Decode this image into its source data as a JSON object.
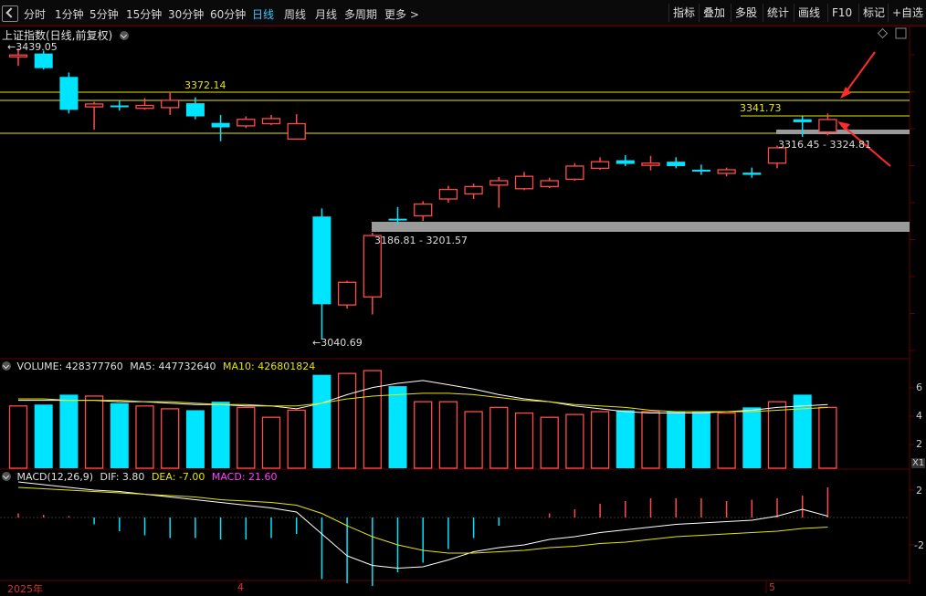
{
  "toolbar": {
    "periods": [
      "分时",
      "1分钟",
      "5分钟",
      "15分钟",
      "30分钟",
      "60分钟",
      "日线",
      "周线",
      "月线",
      "多周期",
      "更多 >"
    ],
    "active": "日线",
    "right_items": [
      "指标",
      "叠加",
      "多股",
      "统计",
      "画线",
      "F10",
      "标记",
      "+自选"
    ]
  },
  "main": {
    "title": "上证指数(日线,前复权)",
    "price_high_label": "3439.05",
    "price_low_label": "3040.69",
    "level_3372": "3372.14",
    "level_3341": "3341.73",
    "gap_upper_label": "3316.45 - 3324.81",
    "gap_lower_label": "3186.81 - 3201.57",
    "up_color": "#ff4a4a",
    "down_color": "#00e5ff",
    "line_color": "#e6e600"
  },
  "volume": {
    "title": "VOLUME: 428377760",
    "ma5": "MA5: 447732640",
    "ma10": "MA10: 426801824",
    "ticks": [
      "6",
      "4",
      "2"
    ],
    "unit": "X1"
  },
  "macd": {
    "title": "MACD(12,26,9)",
    "dif": "DIF: 3.80",
    "dea": "DEA: -7.00",
    "macd": "MACD: 21.60",
    "ticks": [
      "2",
      "-2"
    ]
  },
  "xaxis": {
    "labels": [
      "2025年",
      "4",
      "5"
    ]
  },
  "chart_data": {
    "type": "candlestick",
    "candles": [
      {
        "o": 3430,
        "c": 3430,
        "h": 3439.05,
        "l": 3415,
        "dir": "up"
      },
      {
        "o": 3432,
        "c": 3412,
        "h": 3436,
        "l": 3410,
        "dir": "down"
      },
      {
        "o": 3400,
        "c": 3355,
        "h": 3406,
        "l": 3350,
        "dir": "down"
      },
      {
        "o": 3359,
        "c": 3363,
        "h": 3366,
        "l": 3328,
        "dir": "up"
      },
      {
        "o": 3361,
        "c": 3359,
        "h": 3368,
        "l": 3354,
        "dir": "down"
      },
      {
        "o": 3357,
        "c": 3361,
        "h": 3371,
        "l": 3355,
        "dir": "up"
      },
      {
        "o": 3358,
        "c": 3368,
        "h": 3380,
        "l": 3348,
        "dir": "up"
      },
      {
        "o": 3364,
        "c": 3346,
        "h": 3372.14,
        "l": 3342,
        "dir": "down"
      },
      {
        "o": 3337,
        "c": 3331,
        "h": 3348,
        "l": 3312,
        "dir": "down"
      },
      {
        "o": 3333,
        "c": 3342,
        "h": 3346,
        "l": 3330,
        "dir": "up"
      },
      {
        "o": 3336,
        "c": 3343,
        "h": 3348,
        "l": 3334,
        "dir": "up"
      },
      {
        "o": 3315,
        "c": 3336,
        "h": 3349,
        "l": 3315,
        "dir": "up"
      },
      {
        "o": 3209,
        "c": 3089,
        "h": 3220,
        "l": 3040.69,
        "dir": "down"
      },
      {
        "o": 3088,
        "c": 3119,
        "h": 3121,
        "l": 3083,
        "dir": "up"
      },
      {
        "o": 3099,
        "c": 3183,
        "h": 3186.81,
        "l": 3075,
        "dir": "up"
      },
      {
        "o": 3204,
        "c": 3206,
        "h": 3222,
        "l": 3198,
        "dir": "down"
      },
      {
        "o": 3210,
        "c": 3226,
        "h": 3230,
        "l": 3203,
        "dir": "up"
      },
      {
        "o": 3233,
        "c": 3246,
        "h": 3251,
        "l": 3228,
        "dir": "up"
      },
      {
        "o": 3240,
        "c": 3250,
        "h": 3254,
        "l": 3233,
        "dir": "up"
      },
      {
        "o": 3252,
        "c": 3258,
        "h": 3263,
        "l": 3221,
        "dir": "up"
      },
      {
        "o": 3247,
        "c": 3264,
        "h": 3270,
        "l": 3245,
        "dir": "up"
      },
      {
        "o": 3250,
        "c": 3258,
        "h": 3262,
        "l": 3248,
        "dir": "up"
      },
      {
        "o": 3260,
        "c": 3278,
        "h": 3282,
        "l": 3258,
        "dir": "up"
      },
      {
        "o": 3275,
        "c": 3284,
        "h": 3290,
        "l": 3273,
        "dir": "up"
      },
      {
        "o": 3286,
        "c": 3281,
        "h": 3293,
        "l": 3278,
        "dir": "down"
      },
      {
        "o": 3279,
        "c": 3282,
        "h": 3292,
        "l": 3272,
        "dir": "up"
      },
      {
        "o": 3284,
        "c": 3278,
        "h": 3290,
        "l": 3275,
        "dir": "down"
      },
      {
        "o": 3273,
        "c": 3272,
        "h": 3280,
        "l": 3266,
        "dir": "down"
      },
      {
        "o": 3268,
        "c": 3273,
        "h": 3276,
        "l": 3264,
        "dir": "up"
      },
      {
        "o": 3269,
        "c": 3266,
        "h": 3276,
        "l": 3262,
        "dir": "down"
      },
      {
        "o": 3282,
        "c": 3303,
        "h": 3306,
        "l": 3275,
        "dir": "up"
      },
      {
        "o": 3342,
        "c": 3338,
        "h": 3346,
        "l": 3318,
        "dir": "down"
      },
      {
        "o": 3324.81,
        "c": 3341.73,
        "h": 3350,
        "l": 3320,
        "dir": "up"
      }
    ],
    "volumes": [
      {
        "v": 4.4,
        "dir": "up"
      },
      {
        "v": 4.5,
        "dir": "down"
      },
      {
        "v": 5.2,
        "dir": "down"
      },
      {
        "v": 5.1,
        "dir": "up"
      },
      {
        "v": 4.6,
        "dir": "down"
      },
      {
        "v": 4.4,
        "dir": "up"
      },
      {
        "v": 4.2,
        "dir": "up"
      },
      {
        "v": 4.1,
        "dir": "down"
      },
      {
        "v": 4.7,
        "dir": "down"
      },
      {
        "v": 4.3,
        "dir": "up"
      },
      {
        "v": 3.6,
        "dir": "up"
      },
      {
        "v": 4.1,
        "dir": "up"
      },
      {
        "v": 6.6,
        "dir": "down"
      },
      {
        "v": 6.7,
        "dir": "up"
      },
      {
        "v": 6.9,
        "dir": "up"
      },
      {
        "v": 5.8,
        "dir": "down"
      },
      {
        "v": 4.7,
        "dir": "up"
      },
      {
        "v": 4.7,
        "dir": "up"
      },
      {
        "v": 4.0,
        "dir": "up"
      },
      {
        "v": 4.3,
        "dir": "up"
      },
      {
        "v": 3.9,
        "dir": "up"
      },
      {
        "v": 3.6,
        "dir": "up"
      },
      {
        "v": 3.8,
        "dir": "up"
      },
      {
        "v": 4.0,
        "dir": "up"
      },
      {
        "v": 4.1,
        "dir": "down"
      },
      {
        "v": 4.0,
        "dir": "up"
      },
      {
        "v": 4.0,
        "dir": "down"
      },
      {
        "v": 4.0,
        "dir": "down"
      },
      {
        "v": 3.9,
        "dir": "up"
      },
      {
        "v": 4.3,
        "dir": "down"
      },
      {
        "v": 4.7,
        "dir": "up"
      },
      {
        "v": 5.2,
        "dir": "down"
      },
      {
        "v": 4.3,
        "dir": "up"
      }
    ],
    "macd_hist": [
      0.3,
      0.2,
      0.1,
      -0.5,
      -1.0,
      -1.3,
      -1.5,
      -1.5,
      -1.6,
      -1.6,
      -1.5,
      -1.2,
      -4.5,
      -4.8,
      -5.0,
      -4.0,
      -3.3,
      -2.3,
      -1.5,
      -0.6,
      0,
      0.3,
      0.6,
      1.0,
      1.2,
      1.4,
      1.4,
      1.4,
      1.2,
      1.3,
      1.4,
      1.6,
      2.2
    ],
    "dif": [
      2.6,
      2.4,
      2.2,
      2.0,
      1.9,
      1.7,
      1.5,
      1.3,
      1.1,
      0.9,
      0.7,
      0.4,
      -1.2,
      -2.8,
      -3.5,
      -3.7,
      -3.6,
      -3.1,
      -2.5,
      -2.2,
      -2.0,
      -1.6,
      -1.4,
      -1.1,
      -0.9,
      -0.7,
      -0.5,
      -0.4,
      -0.3,
      -0.2,
      0.1,
      0.6,
      0.1
    ],
    "dea": [
      2.2,
      2.1,
      2.0,
      1.9,
      1.8,
      1.7,
      1.6,
      1.5,
      1.3,
      1.2,
      1.1,
      0.9,
      0.3,
      -0.6,
      -1.4,
      -2.0,
      -2.4,
      -2.6,
      -2.6,
      -2.5,
      -2.4,
      -2.2,
      -2.1,
      -1.9,
      -1.8,
      -1.6,
      -1.4,
      -1.3,
      -1.2,
      -1.1,
      -1.0,
      -0.8,
      -0.7
    ],
    "ma5_vol": [
      4.8,
      4.8,
      4.8,
      4.8,
      4.7,
      4.7,
      4.6,
      4.5,
      4.5,
      4.4,
      4.4,
      4.2,
      4.6,
      5.2,
      5.7,
      6.0,
      6.2,
      5.9,
      5.6,
      5.2,
      4.9,
      4.7,
      4.4,
      4.2,
      4.0,
      3.9,
      3.9,
      3.9,
      4.0,
      4.1,
      4.3,
      4.4,
      4.5
    ],
    "ma10_vol": [
      4.9,
      4.9,
      4.8,
      4.8,
      4.8,
      4.7,
      4.7,
      4.6,
      4.5,
      4.5,
      4.4,
      4.4,
      4.6,
      4.9,
      5.1,
      5.2,
      5.3,
      5.3,
      5.2,
      5.0,
      4.8,
      4.7,
      4.5,
      4.4,
      4.3,
      4.1,
      4.0,
      4.0,
      4.0,
      4.0,
      4.1,
      4.2,
      4.3
    ]
  }
}
